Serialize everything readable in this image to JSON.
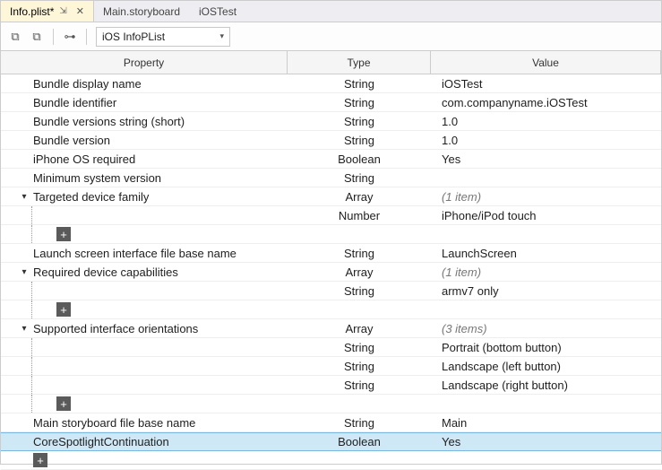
{
  "tabs": [
    {
      "label": "Info.plist*",
      "active": true,
      "pinned": true,
      "closeable": true
    },
    {
      "label": "Main.storyboard",
      "active": false
    },
    {
      "label": "iOSTest",
      "active": false
    }
  ],
  "toolbar": {
    "dropdown_label": "iOS InfoPList"
  },
  "columns": {
    "property": "Property",
    "type": "Type",
    "value": "Value"
  },
  "rows": [
    {
      "indent": 1,
      "toggle": "",
      "property": "Bundle display name",
      "type": "String",
      "value": "iOSTest"
    },
    {
      "indent": 1,
      "toggle": "",
      "property": "Bundle identifier",
      "type": "String",
      "value": "com.companyname.iOSTest"
    },
    {
      "indent": 1,
      "toggle": "",
      "property": "Bundle versions string (short)",
      "type": "String",
      "value": "1.0"
    },
    {
      "indent": 1,
      "toggle": "",
      "property": "Bundle version",
      "type": "String",
      "value": "1.0"
    },
    {
      "indent": 1,
      "toggle": "",
      "property": "iPhone OS required",
      "type": "Boolean",
      "value": "Yes"
    },
    {
      "indent": 1,
      "toggle": "",
      "property": "Minimum system version",
      "type": "String",
      "value": ""
    },
    {
      "indent": 1,
      "toggle": "▾",
      "property": "Targeted device family",
      "type": "Array",
      "value": "(1 item)",
      "italic_value": true
    },
    {
      "indent": 2,
      "toggle": "",
      "tree": true,
      "property": "",
      "type": "Number",
      "value": "iPhone/iPod touch"
    },
    {
      "indent": 2,
      "toggle": "",
      "tree": true,
      "add": true
    },
    {
      "indent": 1,
      "toggle": "",
      "property": "Launch screen interface file base name",
      "type": "String",
      "value": "LaunchScreen"
    },
    {
      "indent": 1,
      "toggle": "▾",
      "property": "Required device capabilities",
      "type": "Array",
      "value": "(1 item)",
      "italic_value": true
    },
    {
      "indent": 2,
      "toggle": "",
      "tree": true,
      "property": "",
      "type": "String",
      "value": "armv7 only"
    },
    {
      "indent": 2,
      "toggle": "",
      "tree": true,
      "add": true
    },
    {
      "indent": 1,
      "toggle": "▾",
      "property": "Supported interface orientations",
      "type": "Array",
      "value": "(3 items)",
      "italic_value": true
    },
    {
      "indent": 2,
      "toggle": "",
      "tree": true,
      "property": "",
      "type": "String",
      "value": "Portrait (bottom button)"
    },
    {
      "indent": 2,
      "toggle": "",
      "tree": true,
      "property": "",
      "type": "String",
      "value": "Landscape (left button)"
    },
    {
      "indent": 2,
      "toggle": "",
      "tree": true,
      "property": "",
      "type": "String",
      "value": "Landscape (right button)"
    },
    {
      "indent": 2,
      "toggle": "",
      "tree": true,
      "add": true
    },
    {
      "indent": 1,
      "toggle": "",
      "property": "Main storyboard file base name",
      "type": "String",
      "value": "Main"
    },
    {
      "indent": 1,
      "toggle": "",
      "property": "CoreSpotlightContinuation",
      "type": "Boolean",
      "value": "Yes",
      "selected": true
    },
    {
      "indent": 1,
      "toggle": "",
      "add": true
    }
  ]
}
